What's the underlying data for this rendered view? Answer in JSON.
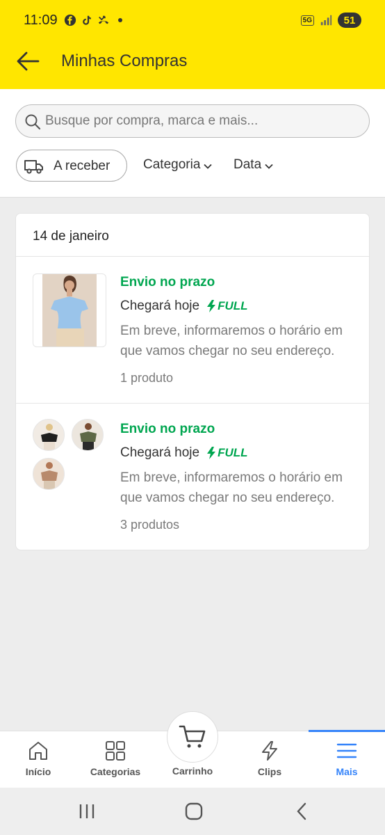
{
  "status_bar": {
    "time": "11:09",
    "network": "5G",
    "battery": "51"
  },
  "header": {
    "title": "Minhas Compras",
    "back_icon": "arrow-left-icon"
  },
  "search": {
    "placeholder": "Busque por compra, marca e mais..."
  },
  "filters": {
    "chip_label": "A receber",
    "category_label": "Categoria",
    "date_label": "Data"
  },
  "orders_group": {
    "date": "14 de janeiro",
    "items": [
      {
        "status": "Envio no prazo",
        "arrival": "Chegará hoje",
        "badge": "FULL",
        "description": "Em breve, informaremos o horário em que vamos chegar no seu endereço.",
        "count": "1 produto"
      },
      {
        "status": "Envio no prazo",
        "arrival": "Chegará hoje",
        "badge": "FULL",
        "description": "Em breve, informaremos o horário em que vamos chegar no seu endereço.",
        "count": "3 produtos"
      }
    ]
  },
  "bottom_nav": {
    "items": [
      {
        "label": "Início",
        "icon": "home-icon"
      },
      {
        "label": "Categorias",
        "icon": "grid-icon"
      },
      {
        "label": "Carrinho",
        "icon": "cart-icon"
      },
      {
        "label": "Clips",
        "icon": "lightning-icon"
      },
      {
        "label": "Mais",
        "icon": "menu-icon"
      }
    ],
    "active": "Mais"
  },
  "colors": {
    "brand_yellow": "#ffe600",
    "success_green": "#00a650",
    "active_blue": "#3483fa"
  }
}
